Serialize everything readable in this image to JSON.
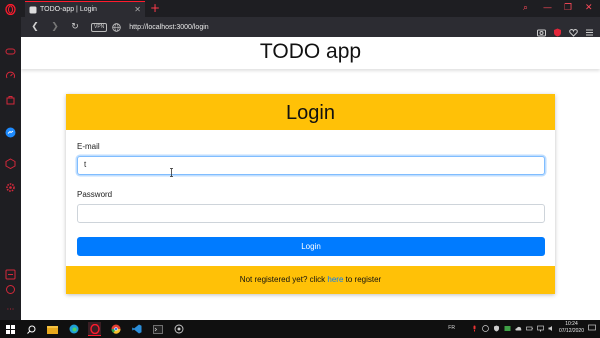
{
  "browser": {
    "tab_title": "TODO-app | Login",
    "url": "http://localhost:3000/login",
    "vpn_label": "VPN",
    "accent": "#ff1b2d"
  },
  "page": {
    "app_title": "TODO app",
    "login_title": "Login",
    "email_label": "E-mail",
    "email_value": "t",
    "password_label": "Password",
    "password_value": "",
    "login_button": "Login",
    "footer_prefix": "Not registered yet? click ",
    "footer_link": "here",
    "footer_suffix": " to register",
    "card_color": "#ffc107",
    "button_color": "#007bff"
  },
  "taskbar": {
    "language": "FR",
    "time": "10:24",
    "date": "07/12/2020"
  },
  "icons": [
    "opera-logo-icon",
    "gamepad-icon",
    "speed-icon",
    "bag-icon",
    "messenger-icon",
    "cube-icon",
    "settings-icon",
    "windows-start-icon",
    "search-icon",
    "file-explorer-icon",
    "edge-icon",
    "opera-icon",
    "chrome-icon",
    "vscode-icon",
    "terminal-icon",
    "app-icon"
  ]
}
